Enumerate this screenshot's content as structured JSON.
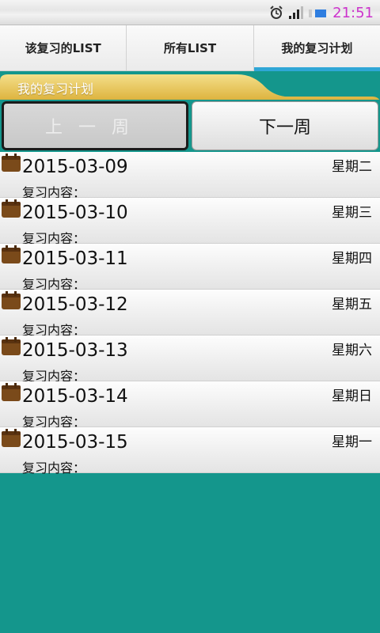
{
  "status_bar": {
    "time": "21:51",
    "icons": [
      "alarm-icon",
      "signal-icon",
      "battery-icon"
    ]
  },
  "tabs": [
    {
      "label": "该复习的LIST",
      "active": false
    },
    {
      "label": "所有LIST",
      "active": false
    },
    {
      "label": "我的复习计划",
      "active": true
    }
  ],
  "section": {
    "title": "我的复习计划"
  },
  "week_nav": {
    "prev_label": "上一周",
    "next_label": "下一周"
  },
  "plan_items": [
    {
      "date": "2015-03-09",
      "weekday": "星期二",
      "content_label": "复习内容："
    },
    {
      "date": "2015-03-10",
      "weekday": "星期三",
      "content_label": "复习内容："
    },
    {
      "date": "2015-03-11",
      "weekday": "星期四",
      "content_label": "复习内容："
    },
    {
      "date": "2015-03-12",
      "weekday": "星期五",
      "content_label": "复习内容："
    },
    {
      "date": "2015-03-13",
      "weekday": "星期六",
      "content_label": "复习内容："
    },
    {
      "date": "2015-03-14",
      "weekday": "星期日",
      "content_label": "复习内容："
    },
    {
      "date": "2015-03-15",
      "weekday": "星期一",
      "content_label": "复习内容："
    }
  ],
  "colors": {
    "background": "#14968c",
    "tab_indicator": "#2fa6d6",
    "section_banner": "#e8c050",
    "status_time": "#cc33cc"
  }
}
